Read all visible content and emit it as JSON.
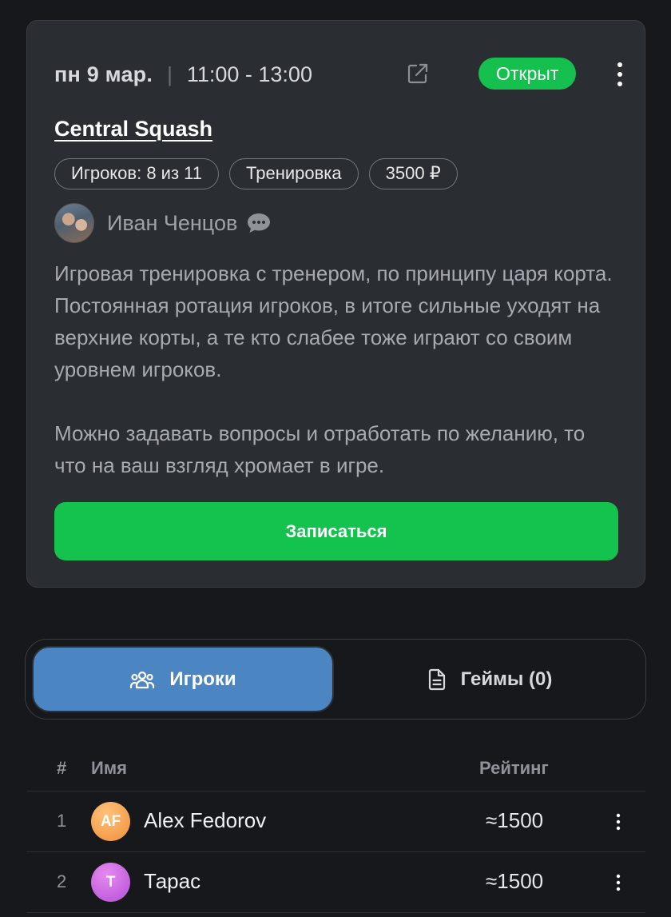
{
  "event": {
    "date": "пн 9 мар.",
    "separator": "|",
    "time": "11:00 - 13:00",
    "status": "Открыт",
    "venue": "Central Squash",
    "tags": [
      "Игроков: 8 из 11",
      "Тренировка",
      "3500 ₽"
    ],
    "author": "Иван Ченцов",
    "description": [
      "Игровая тренировка с тренером, по принципу царя корта. Постоянная ротация игроков, в итоге сильные уходят на верхние корты, а те кто слабее тоже играют со своим уровнем игроков.",
      "Можно задавать вопросы и отработать по желанию, то что на ваш взгляд хромает в игре."
    ],
    "join_label": "Записаться"
  },
  "tabs": {
    "players": "Игроки",
    "games": "Геймы (0)"
  },
  "table": {
    "headers": {
      "num": "#",
      "name": "Имя",
      "rating": "Рейтинг"
    },
    "rows": [
      {
        "idx": "1",
        "initials": "AF",
        "name": "Alex Fedorov",
        "rating": "≈1500",
        "avatar_color": "#f7a24a"
      },
      {
        "idx": "2",
        "initials": "T",
        "name": "Тарас",
        "rating": "≈1500",
        "avatar_color": "#c85de0"
      }
    ]
  },
  "colors": {
    "accent_green": "#14c24e",
    "tab_active": "#4b86c3"
  },
  "icons": [
    "external-link-icon",
    "more-vertical-icon",
    "chat-bubble-icon",
    "users-icon",
    "document-icon"
  ]
}
